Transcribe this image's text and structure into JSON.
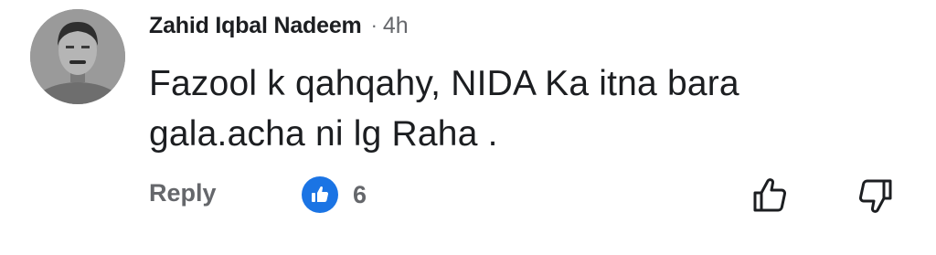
{
  "comment": {
    "author": "Zahid Iqbal Nadeem",
    "separator": "·",
    "time": "4h",
    "text_line1": "Fazool k qahqahy, NIDA Ka itna bara",
    "text_line2": "gala.acha ni lg Raha ."
  },
  "actions": {
    "reply_label": "Reply",
    "reaction_count": "6",
    "reaction_icon": "like-icon",
    "thumb_up_icon": "thumb-up-outline-icon",
    "thumb_down_icon": "thumb-down-outline-icon"
  },
  "colors": {
    "text_primary": "#1c1e21",
    "text_secondary": "#65676b",
    "like_blue": "#1b74e4"
  }
}
